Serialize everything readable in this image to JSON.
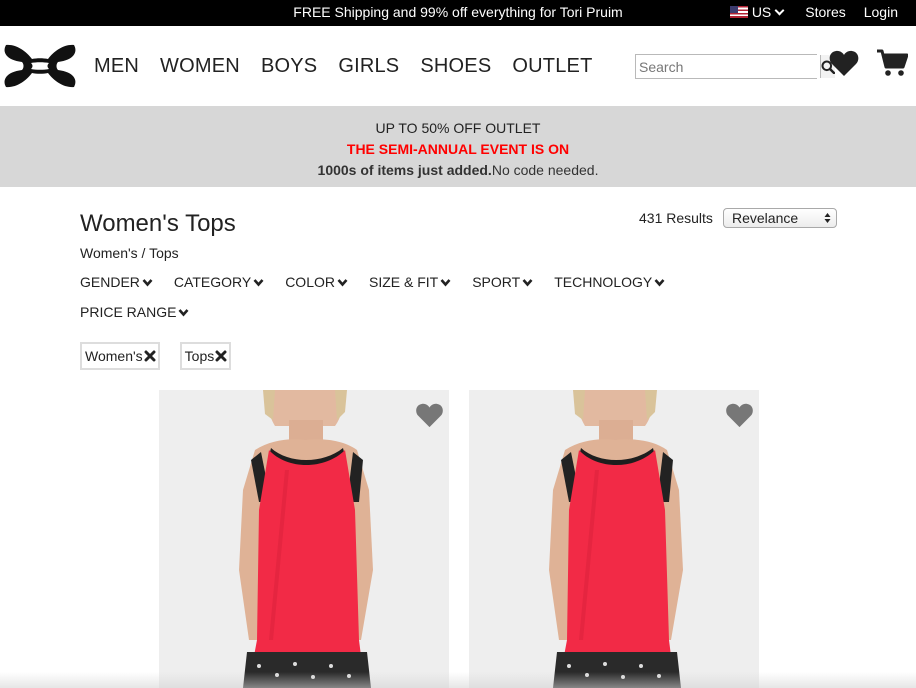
{
  "topbar": {
    "promo": "FREE Shipping and 99% off everything for Tori Pruim",
    "country": "US",
    "stores": "Stores",
    "login": "Login"
  },
  "header": {
    "nav": [
      "MEN",
      "WOMEN",
      "BOYS",
      "GIRLS",
      "SHOES",
      "OUTLET"
    ],
    "search_placeholder": "Search"
  },
  "banner": {
    "line1": "UP TO 50% OFF OUTLET",
    "line2": "THE SEMI-ANNUAL EVENT IS ON",
    "line3_bold": "1000s of items just added.",
    "line3_rest": "No code needed."
  },
  "listing": {
    "title": "Women's Tops",
    "breadcrumb": "Women's / Tops",
    "results": "431 Results",
    "sort_value": "Revelance"
  },
  "filters": [
    "GENDER",
    "CATEGORY",
    "COLOR",
    "SIZE & FIT",
    "SPORT",
    "TECHNOLOGY",
    "PRICE RANGE"
  ],
  "active_filters": [
    "Women's",
    "Tops"
  ],
  "colors": {
    "accent_red": "#ff0000",
    "tank_top": "#f22a46",
    "banner_bg": "#d7d7d7"
  }
}
